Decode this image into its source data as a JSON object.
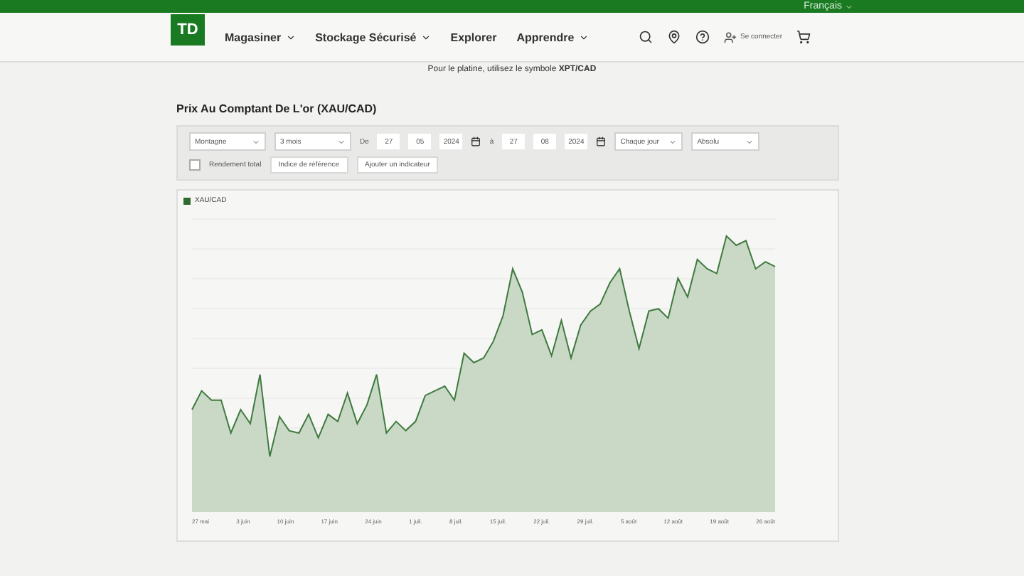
{
  "top_bar": {
    "language": "Français"
  },
  "nav": {
    "logo": "TD",
    "items": [
      {
        "label": "Magasiner",
        "has_menu": true
      },
      {
        "label": "Stockage Sécurisé",
        "has_menu": true
      },
      {
        "label": "Explorer",
        "has_menu": false
      },
      {
        "label": "Apprendre",
        "has_menu": true
      }
    ],
    "sign_in": "Se connecter"
  },
  "notice": {
    "text": "Pour le platine, utilisez le symbole **XPT/CAD**"
  },
  "title": "Prix Au Comptant De L'or (XAU/CAD)",
  "controls": {
    "timezone": "Montagne",
    "period": "3 mois",
    "from_label": "De",
    "from": [
      "27",
      "05",
      "2024"
    ],
    "to_label": "à",
    "to": [
      "27",
      "08",
      "2024"
    ],
    "interval": "Chaque jour",
    "chart_type": "Absolu",
    "total_return": {
      "label": "Rendement total",
      "checked": false
    },
    "benchmark": "Indice de référence",
    "add_indicator": "Ajouter un indicateur"
  },
  "chart": {
    "legend": "XAU/CAD",
    "x_labels": [
      "27 mai",
      "3 juin",
      "10 juin",
      "17 juin",
      "24 juin",
      "1 juil.",
      "8 juil.",
      "15 juil.",
      "22 juil.",
      "29 juil.",
      "5 août",
      "12 août",
      "19 août",
      "26 août"
    ]
  }
}
